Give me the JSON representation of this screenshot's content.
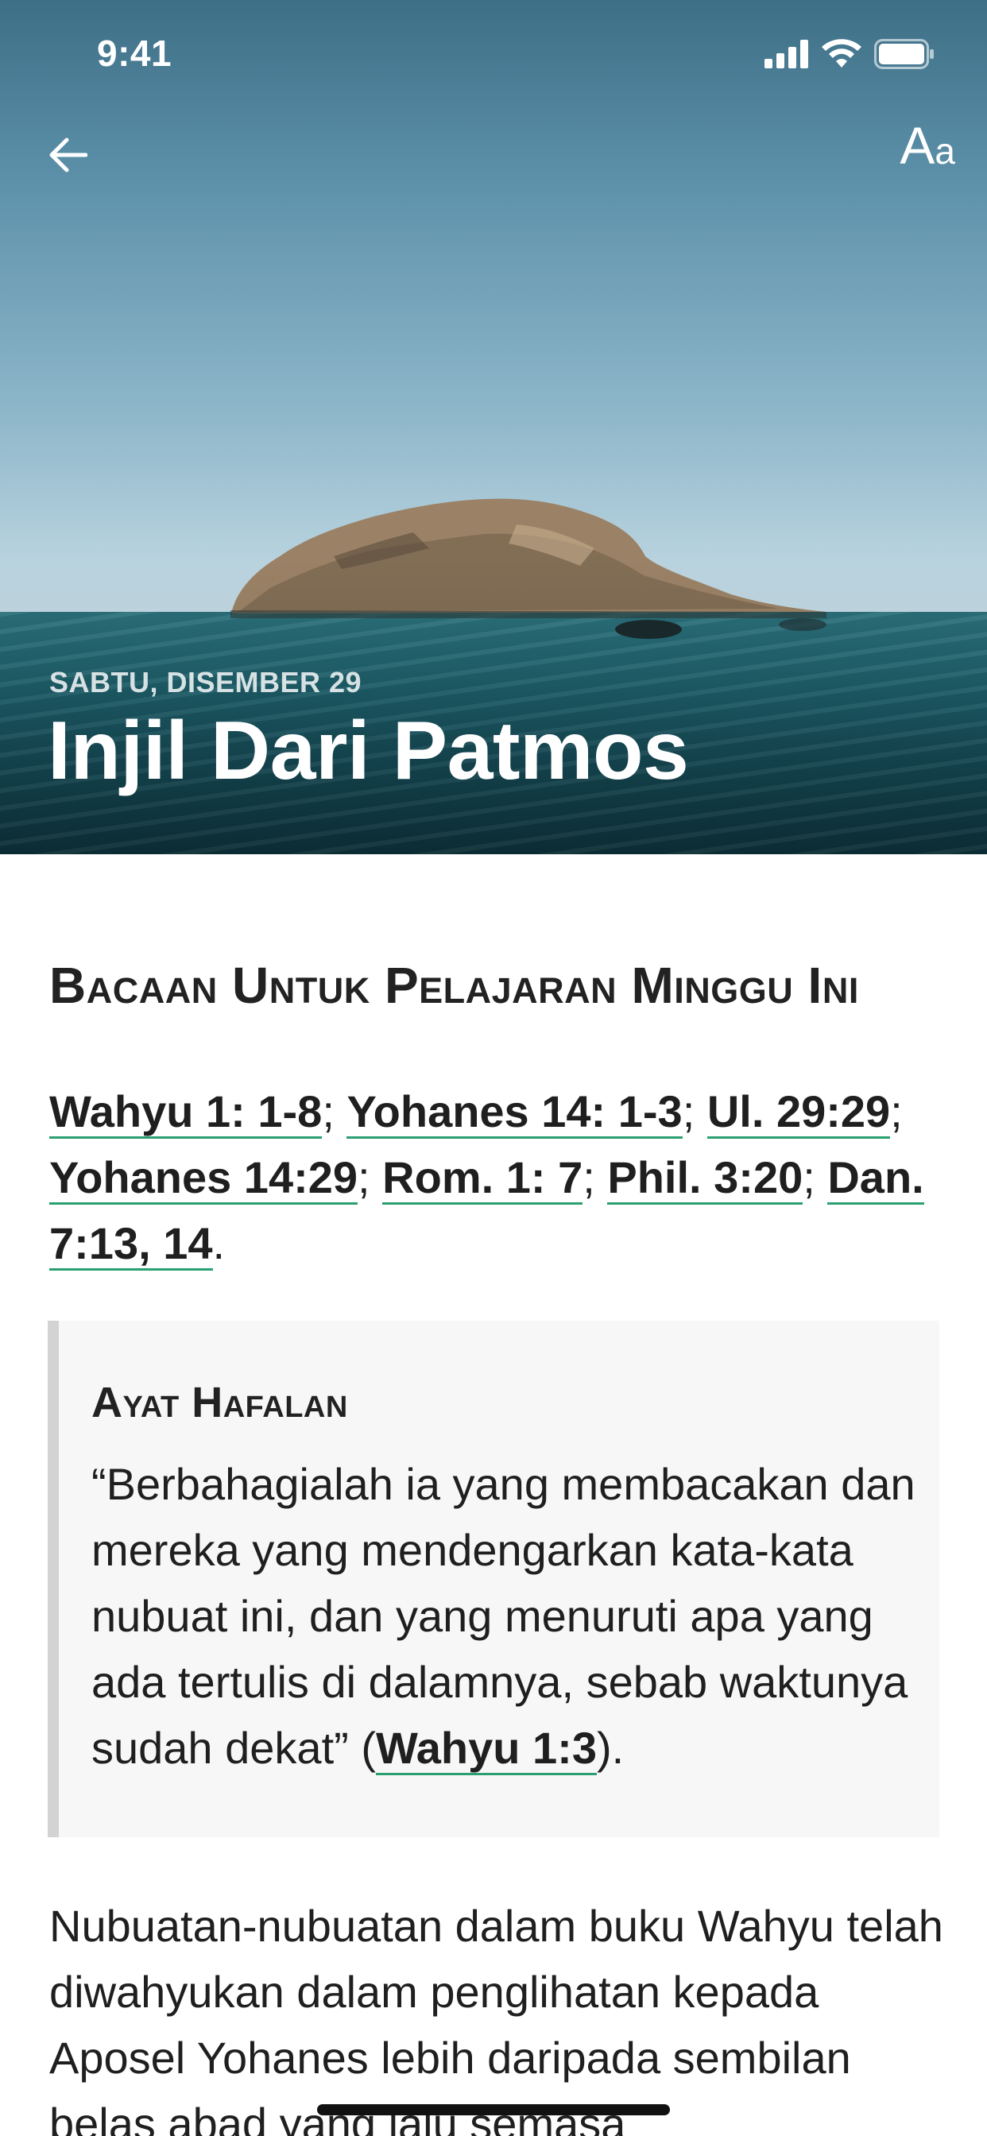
{
  "status_bar": {
    "time": "9:41",
    "signal_icon": "cellular-signal-icon",
    "wifi_icon": "wifi-icon",
    "battery_icon": "battery-icon"
  },
  "nav": {
    "back_icon": "arrow-left-icon",
    "font_size_label_big": "A",
    "font_size_label_small": "a"
  },
  "hero": {
    "date": "SABTU, DISEMBER 29",
    "title": "Injil Dari Patmos",
    "image": "sea-island-photo"
  },
  "lesson": {
    "reading_heading": "Bacaan Untuk Pelajaran Minggu Ini",
    "references": [
      "Wahyu 1: 1-8",
      "Yohanes 14: 1-3",
      "Ul. 29:29",
      "Yohanes 14:29",
      "Rom. 1: 7",
      "Phil. 3:20",
      "Dan. 7:13, 14"
    ],
    "memory_verse": {
      "title": "Ayat Hafalan",
      "text": "“Berbahagialah ia yang membacakan dan mereka yang mendengarkan kata-kata nubuat ini, dan yang menuruti apa yang ada tertulis di dalamnya, sebab waktunya sudah dekat” (",
      "reference": "Wahyu 1:3",
      "closing": ")."
    },
    "body": "Nubuatan-nubuatan dalam buku Wahyu telah diwahyukan dalam penglihatan kepada Aposel Yohanes lebih daripada sembilan belas abad yang lalu semasa pengasingannya"
  },
  "colors": {
    "link_underline": "#2aa070",
    "quote_bar": "#d3d3d3",
    "quote_bg": "#f7f7f7",
    "text": "#1f1f1f"
  }
}
